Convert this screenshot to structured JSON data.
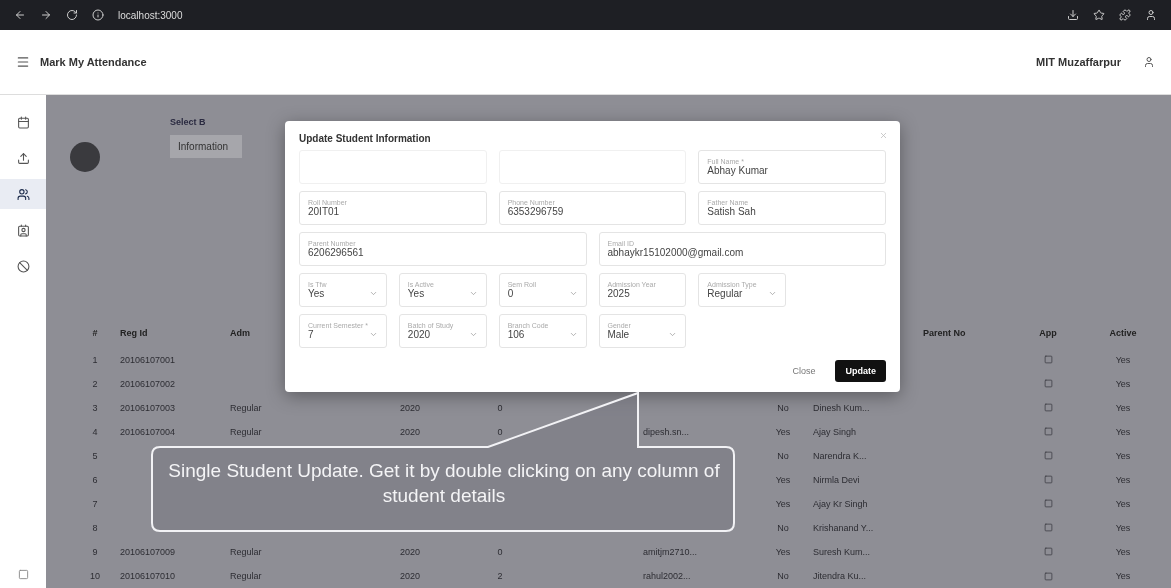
{
  "browser": {
    "url": "localhost:3000"
  },
  "app_bar": {
    "title": "Mark My Attendance",
    "institute": "MIT Muzaffarpur"
  },
  "sidebar": {
    "items": [
      {
        "selected": false
      },
      {
        "selected": false
      },
      {
        "selected": true
      },
      {
        "selected": false
      },
      {
        "selected": false
      }
    ]
  },
  "filter": {
    "label": "Select B",
    "value": "Information"
  },
  "table": {
    "columns": [
      "#",
      "Reg Id",
      "Adm",
      "",
      "",
      "",
      "",
      "",
      "",
      "Parent No",
      "App",
      "Active"
    ],
    "rows": [
      {
        "no": "1",
        "reg_id": "20106107001",
        "app": false,
        "active": "Yes"
      },
      {
        "no": "2",
        "reg_id": "20106107002",
        "app": false,
        "active": "Yes"
      },
      {
        "no": "3",
        "reg_id": "20106107003",
        "adm_type": "Regular",
        "year": "2020",
        "sem": "0",
        "tfw": "No",
        "father": "Dinesh Kum...",
        "app": false,
        "active": "Yes"
      },
      {
        "no": "4",
        "reg_id": "20106107004",
        "adm_type": "Regular",
        "year": "2020",
        "sem": "0",
        "email": "dipesh.sn...",
        "tfw": "Yes",
        "father": "Ajay Singh",
        "app": false,
        "active": "Yes"
      },
      {
        "no": "5",
        "tfw": "No",
        "father": "Narendra K...",
        "app": false,
        "active": "Yes"
      },
      {
        "no": "6",
        "tfw": "Yes",
        "father": "Nirmla Devi",
        "app": false,
        "active": "Yes"
      },
      {
        "no": "7",
        "tfw": "Yes",
        "father": "Ajay Kr Singh",
        "app": false,
        "active": "Yes"
      },
      {
        "no": "8",
        "tfw": "No",
        "father": "Krishanand Y...",
        "app": false,
        "active": "Yes"
      },
      {
        "no": "9",
        "reg_id": "20106107009",
        "adm_type": "Regular",
        "year": "2020",
        "sem": "0",
        "email": "amitjm2710...",
        "tfw": "Yes",
        "father": "Suresh Kum...",
        "app": false,
        "active": "Yes"
      },
      {
        "no": "10",
        "reg_id": "20106107010",
        "adm_type": "Regular",
        "year": "2020",
        "sem": "2",
        "email": "rahul2002...",
        "tfw": "No",
        "father": "Jitendra Ku...",
        "app": false,
        "active": "Yes"
      }
    ]
  },
  "dialog": {
    "title": "Update Student Information",
    "lines": [
      {
        "fields": [
          {
            "kind": "text",
            "disabled": true
          },
          {
            "kind": "text",
            "disabled": true
          },
          {
            "kind": "text",
            "label": "Full Name *",
            "value": "Abhay Kumar",
            "disabled": false
          }
        ]
      },
      {
        "fields": [
          {
            "kind": "text",
            "label": "Roll Number",
            "value": "20IT01",
            "disabled": false
          },
          {
            "kind": "text",
            "label": "Phone Number",
            "value": "6353296759",
            "disabled": false
          },
          {
            "kind": "text",
            "label": "Father Name",
            "value": "Satish Sah",
            "disabled": false
          }
        ]
      },
      {
        "fields": [
          {
            "kind": "text",
            "label": "Parent Number",
            "value": "6206296561",
            "disabled": false
          },
          {
            "kind": "text",
            "label": "Email ID",
            "value": "abhaykr15102000@gmail.com",
            "disabled": false
          }
        ]
      },
      {
        "fields": [
          {
            "kind": "select",
            "label": "Is Tfw",
            "value": "Yes",
            "disabled": false
          },
          {
            "kind": "select",
            "label": "Is Active",
            "value": "Yes",
            "disabled": false
          },
          {
            "kind": "select",
            "label": "Sem Roll",
            "value": "0",
            "disabled": false
          },
          {
            "kind": "text",
            "label": "Admission Year",
            "value": "2025",
            "disabled": false
          },
          {
            "kind": "select",
            "label": "Admission Type",
            "value": "Regular",
            "disabled": false
          }
        ]
      },
      {
        "fields": [
          {
            "kind": "select",
            "label": "Current Semester *",
            "value": "7",
            "disabled": false
          },
          {
            "kind": "select",
            "label": "Batch of Study",
            "value": "2020",
            "disabled": false
          },
          {
            "kind": "select",
            "label": "Branch Code",
            "value": "106",
            "disabled": false
          },
          {
            "kind": "select",
            "label": "Gender",
            "value": "Male",
            "disabled": false
          }
        ]
      }
    ],
    "buttons": [
      {
        "kind": "text",
        "label": "Close"
      },
      {
        "kind": "primary",
        "label": "Update"
      }
    ]
  },
  "callout": {
    "text": "Single Student Update. Get it by double clicking on any column of  student details"
  }
}
